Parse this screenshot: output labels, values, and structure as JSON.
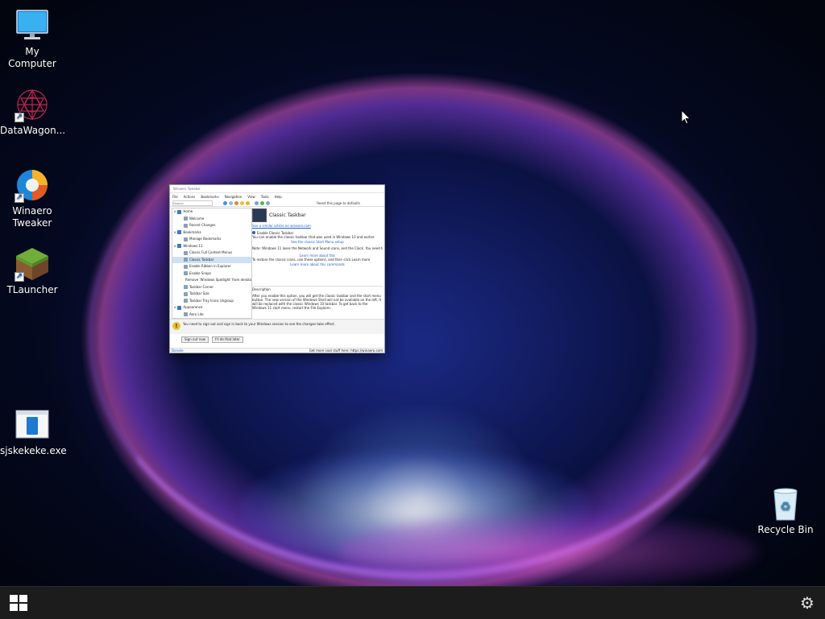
{
  "desktop_icons": [
    {
      "label": "My Computer",
      "icon": "monitor-icon"
    },
    {
      "label": "DataWagon...",
      "icon": "datawagon-icon",
      "shortcut": true
    },
    {
      "label": "Winaero Tweaker",
      "icon": "winaero-tweaker-icon",
      "shortcut": true
    },
    {
      "label": "TLauncher",
      "icon": "minecraft-grass-block-icon",
      "shortcut": true
    },
    {
      "label": "sjskekeke.exe",
      "icon": "exe-file-icon"
    },
    {
      "label": "Recycle Bin",
      "icon": "recycle-bin-icon"
    }
  ],
  "window": {
    "title": "Winaero Tweaker",
    "menu": [
      "File",
      "Actions",
      "Bookmarks",
      "Navigation",
      "View",
      "Tools",
      "Help"
    ],
    "search_placeholder": "Search",
    "toolbar_right": "Reset this page to defaults",
    "tree": [
      {
        "label": "Home",
        "level": 0,
        "expand": "v"
      },
      {
        "label": "Welcome",
        "level": 1
      },
      {
        "label": "Recent Changes",
        "level": 1
      },
      {
        "label": "Bookmarks",
        "level": 0,
        "expand": "v"
      },
      {
        "label": "Manage Bookmarks",
        "level": 1
      },
      {
        "label": "Windows 11",
        "level": 0,
        "expand": "v"
      },
      {
        "label": "Classic Full Context Menus",
        "level": 1
      },
      {
        "label": "Classic Taskbar",
        "level": 1,
        "selected": true
      },
      {
        "label": "Enable Ribbon in Explorer",
        "level": 1
      },
      {
        "label": "Enable Snaps",
        "level": 1
      },
      {
        "label": "Remove 'Windows Spotlight' from desktop",
        "level": 1
      },
      {
        "label": "Taskbar Corner",
        "level": 1
      },
      {
        "label": "Taskbar Size",
        "level": 1
      },
      {
        "label": "Taskbar Tray Icons Ungroup",
        "level": 1
      },
      {
        "label": "Appearance",
        "level": 0,
        "expand": "v"
      },
      {
        "label": "Aero Lite",
        "level": 1
      }
    ],
    "content": {
      "heading": "Classic Taskbar",
      "link_top": "See a similar article on winaero.com",
      "option": "Enable Classic Taskbar",
      "lines": [
        "You can enable the classic taskbar that was used in Windows 10 and earlier.",
        "Note: Windows 11 loses the Network and Sound icons, and the Clock. You need to enable them.",
        "To restore the classic icons, use these options, and then click Learn more"
      ],
      "links": [
        "See the classic Start Menu setup",
        "Learn more about this",
        "Learn more about this commands"
      ],
      "description_title": "Description",
      "description": "After you enable this option, you will get the classic taskbar and the start menu button. The new version of the Windows Shell will not be available on the left. It will be replaced with the classic Windows 10 taskbar. To get back to the Windows 11 start menu, restart the File Explorer."
    },
    "notice": "You need to sign out and sign in back to your Windows session to see the changes take effect.",
    "buttons": [
      "Sign out now",
      "I'll do that later"
    ],
    "status_left": "Donate",
    "status_right": "Get more cool stuff here: https://winaero.com"
  },
  "taskbar": {
    "start_icon": "windows-start-icon",
    "tray_icon": "gear-icon"
  },
  "colors": {
    "taskbar": "#1c1c1c",
    "link": "#1e5fd6",
    "selection": "#cfe0f5"
  }
}
